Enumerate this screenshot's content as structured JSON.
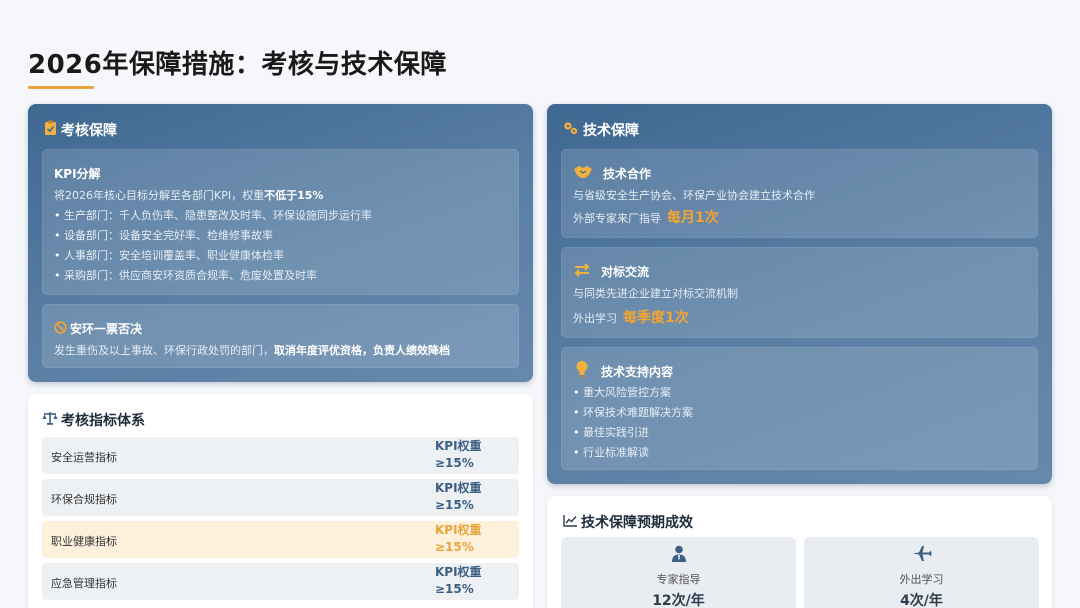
{
  "page": {
    "title": "2026年保障措施：考核与技术保障"
  },
  "assessment": {
    "title": "考核保障",
    "kpi": {
      "title": "KPI分解",
      "intro_prefix": "将2026年核心目标分解至各部门KPI，权重",
      "intro_bold": "不低于15%",
      "items": [
        "生产部门：千人负伤率、隐患整改及时率、环保设施同步运行率",
        "设备部门：设备安全完好率、检维修事故率",
        "人事部门：安全培训覆盖率、职业健康体检率",
        "采购部门：供应商安环资质合规率、危废处置及时率"
      ]
    },
    "veto": {
      "title": "安环一票否决",
      "text_prefix": "发生重伤及以上事故、环保行政处罚的部门，",
      "text_bold": "取消年度评优资格，负责人绩效降档"
    }
  },
  "technical": {
    "title": "技术保障",
    "cooperation": {
      "title": "技术合作",
      "text": "与省级安全生产协会、环保产业协会建立技术合作",
      "freq_label": "外部专家来厂指导",
      "freq_value": "每月1次"
    },
    "benchmark": {
      "title": "对标交流",
      "text": "与同类先进企业建立对标交流机制",
      "freq_label": "外出学习",
      "freq_value": "每季度1次"
    },
    "support": {
      "title": "技术支持内容",
      "items": [
        "重大风险管控方案",
        "环保技术难题解决方案",
        "最佳实践引进",
        "行业标准解读"
      ]
    }
  },
  "indicator_system": {
    "title": "考核指标体系",
    "rows": [
      {
        "name": "安全运营指标",
        "weight_line1": "KPI权重",
        "weight_line2": "≥15%",
        "highlight": false
      },
      {
        "name": "环保合规指标",
        "weight_line1": "KPI权重",
        "weight_line2": "≥15%",
        "highlight": false
      },
      {
        "name": "职业健康指标",
        "weight_line1": "KPI权重",
        "weight_line2": "≥15%",
        "highlight": true
      },
      {
        "name": "应急管理指标",
        "weight_line1": "KPI权重",
        "weight_line2": "≥15%",
        "highlight": false
      }
    ]
  },
  "outcomes": {
    "title": "技术保障预期成效",
    "stats": [
      {
        "label": "专家指导",
        "value": "12次/年",
        "icon": "user-tie-icon"
      },
      {
        "label": "外出学习",
        "value": "4次/年",
        "icon": "plane-icon"
      }
    ]
  },
  "colors": {
    "accent": "#e8a53a",
    "panel_blue": "#4a7098",
    "kpi_text": "#3d5f82",
    "highlight_bg": "#fdf1dc"
  }
}
